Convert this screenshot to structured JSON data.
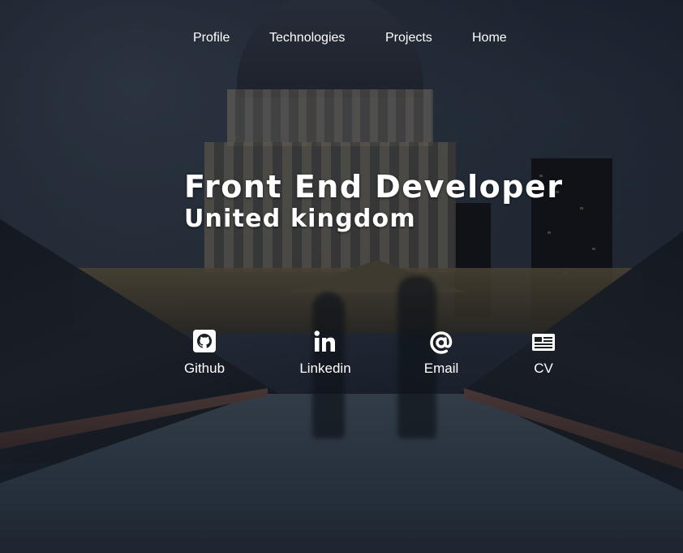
{
  "nav": {
    "items": [
      {
        "label": "Profile"
      },
      {
        "label": "Technologies"
      },
      {
        "label": "Projects"
      },
      {
        "label": "Home"
      }
    ]
  },
  "hero": {
    "title": "Front End Developer",
    "subtitle": "United kingdom"
  },
  "links": [
    {
      "label": "Github",
      "icon": "github-icon"
    },
    {
      "label": "Linkedin",
      "icon": "linkedin-icon"
    },
    {
      "label": "Email",
      "icon": "at-sign-icon"
    },
    {
      "label": "CV",
      "icon": "newspaper-icon"
    }
  ],
  "colors": {
    "text": "#ffffff",
    "background": "#1a222c"
  }
}
